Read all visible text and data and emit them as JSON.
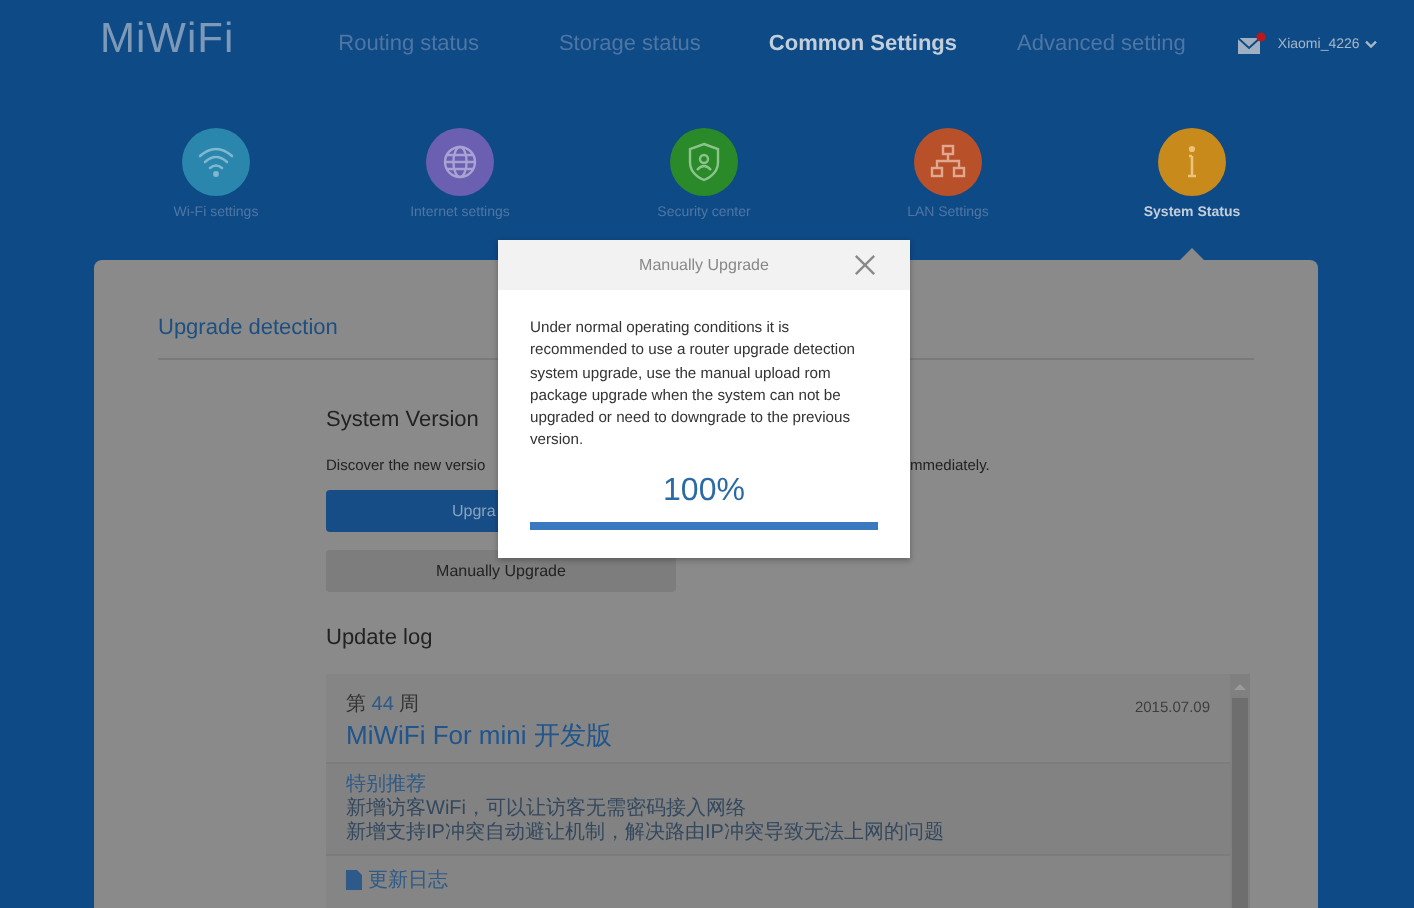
{
  "header": {
    "logo": "MiWiFi",
    "nav": [
      {
        "label": "Routing status",
        "selected": false
      },
      {
        "label": "Storage status",
        "selected": false
      },
      {
        "label": "Common Settings",
        "selected": true
      },
      {
        "label": "Advanced setting",
        "selected": false
      }
    ],
    "mail_unread": true,
    "user": "Xiaomi_4226"
  },
  "settings_tabs": [
    {
      "kind": "wifi",
      "label": "Wi-Fi settings",
      "color": "#2a86ad",
      "selected": false
    },
    {
      "kind": "globe",
      "label": "Internet settings",
      "color": "#6a5fb0",
      "selected": false
    },
    {
      "kind": "shield",
      "label": "Security center",
      "color": "#2a8a2a",
      "selected": false
    },
    {
      "kind": "lan",
      "label": "LAN Settings",
      "color": "#b8502a",
      "selected": false
    },
    {
      "kind": "info",
      "label": "System Status",
      "color": "#c98a1c",
      "selected": true
    }
  ],
  "card": {
    "title": "Upgrade detection",
    "section_title": "System Version",
    "discover_text_left": "Discover the new versio",
    "discover_text_right": "mmediately.",
    "upgrade_button": "Upgra",
    "manual_button": "Manually Upgrade",
    "log_title": "Update log",
    "log_entry": {
      "week_prefix": "第",
      "week_number": "44",
      "week_suffix": "周",
      "date": "2015.07.09",
      "title": "MiWiFi For mini 开发版",
      "feature_heading": "特别推荐",
      "features": [
        "新增访客WiFi，可以让访客无需密码接入网络",
        "新增支持IP冲突自动避让机制，解决路由IP冲突导致无法上网的问题"
      ],
      "changelog_heading": "更新日志"
    }
  },
  "dialog": {
    "title": "Manually Upgrade",
    "body": "Under normal operating conditions it is recommended to use a router upgrade detection system upgrade, use the manual upload rom package upgrade when the system can not be upgraded or need to downgrade to the previous version.",
    "percent": "100%",
    "level": 1
  }
}
